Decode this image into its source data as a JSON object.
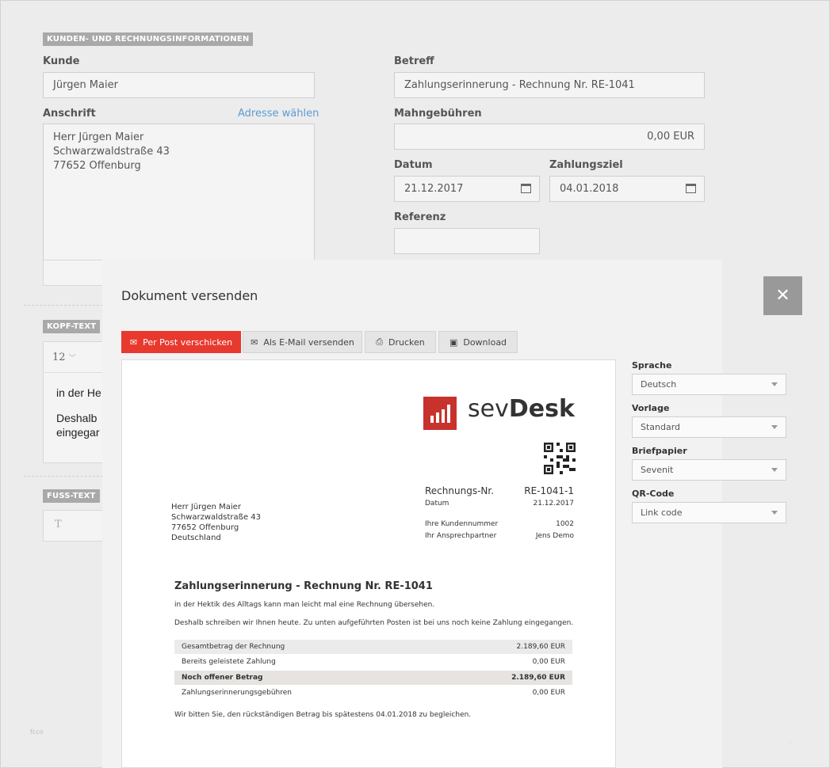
{
  "form": {
    "section_label": "KUNDEN- UND RECHNUNGSINFORMATIONEN",
    "kunde_label": "Kunde",
    "kunde_value": "Jürgen Maier",
    "anschrift_label": "Anschrift",
    "adresse_link": "Adresse wählen",
    "anschrift_lines": [
      "Herr Jürgen Maier",
      "Schwarzwaldstraße 43",
      "77652 Offenburg"
    ],
    "betreff_label": "Betreff",
    "betreff_value": "Zahlungserinnerung - Rechnung Nr. RE-1041",
    "mahngebuehren_label": "Mahngebühren",
    "mahngebuehren_value": "0,00 EUR",
    "datum_label": "Datum",
    "datum_value": "21.12.2017",
    "zahlungsziel_label": "Zahlungsziel",
    "zahlungsziel_value": "04.01.2018",
    "referenz_label": "Referenz",
    "referenz_value": "",
    "kopftext_label": "KOPF-TEXT",
    "kopftext_fontsize": "12",
    "kopftext_lines": [
      "in der He",
      "Deshalb",
      "eingegar"
    ],
    "fusstext_label": "FUSS-TEXT",
    "fusstext_glyph": "T"
  },
  "modal": {
    "title": "Dokument versenden",
    "close_glyph": "✕",
    "tabs": [
      {
        "label": "Per Post verschicken",
        "icon": "envelope-icon",
        "active": true
      },
      {
        "label": "Als E-Mail versenden",
        "icon": "envelope-icon",
        "active": false
      },
      {
        "label": "Drucken",
        "icon": "printer-icon",
        "active": false
      },
      {
        "label": "Download",
        "icon": "save-icon",
        "active": false
      }
    ],
    "icon_glyphs": {
      "envelope": "✉",
      "printer": "⎙",
      "save": "▣"
    },
    "sidebar": {
      "sprache_label": "Sprache",
      "sprache_value": "Deutsch",
      "vorlage_label": "Vorlage",
      "vorlage_value": "Standard",
      "briefpapier_label": "Briefpapier",
      "briefpapier_value": "Sevenit",
      "qrcode_label": "QR-Code",
      "qrcode_value": "Link code"
    }
  },
  "document": {
    "logo_text_light": "sev",
    "logo_text_bold": "Desk",
    "rechnungsnr_label": "Rechnungs-Nr.",
    "rechnungsnr_value": "RE-1041-1",
    "datum_label": "Datum",
    "datum_value": "21.12.2017",
    "kundennummer_label": "Ihre Kundennummer",
    "kundennummer_value": "1002",
    "ansprechpartner_label": "Ihr Ansprechpartner",
    "ansprechpartner_value": "Jens Demo",
    "address_lines": [
      "Herr Jürgen Maier",
      "Schwarzwaldstraße 43",
      "77652 Offenburg",
      "Deutschland"
    ],
    "heading": "Zahlungserinnerung - Rechnung Nr. RE-1041",
    "intro_1": "in der Hektik des Alltags kann man leicht mal eine Rechnung übersehen.",
    "intro_2": "Deshalb schreiben wir Ihnen heute. Zu unten aufgeführten Posten ist bei uns noch keine Zahlung eingegangen.",
    "summary": [
      {
        "label": "Gesamtbetrag der Rechnung",
        "value": "2.189,60 EUR"
      },
      {
        "label": "Bereits geleistete Zahlung",
        "value": "0,00 EUR"
      },
      {
        "label": "Noch offener Betrag",
        "value": "2.189,60 EUR"
      },
      {
        "label": "Zahlungserinnerungsgebühren",
        "value": "0,00 EUR"
      }
    ],
    "closing": "Wir bitten Sie, den rückständigen Betrag bis spätestens 04.01.2018 zu begleichen."
  },
  "footer": {
    "left_mark": "fcco",
    "right_mark": "·"
  },
  "colors": {
    "accent": "#e8392e",
    "brand": "#c8322c",
    "link": "#5b9bd5"
  }
}
